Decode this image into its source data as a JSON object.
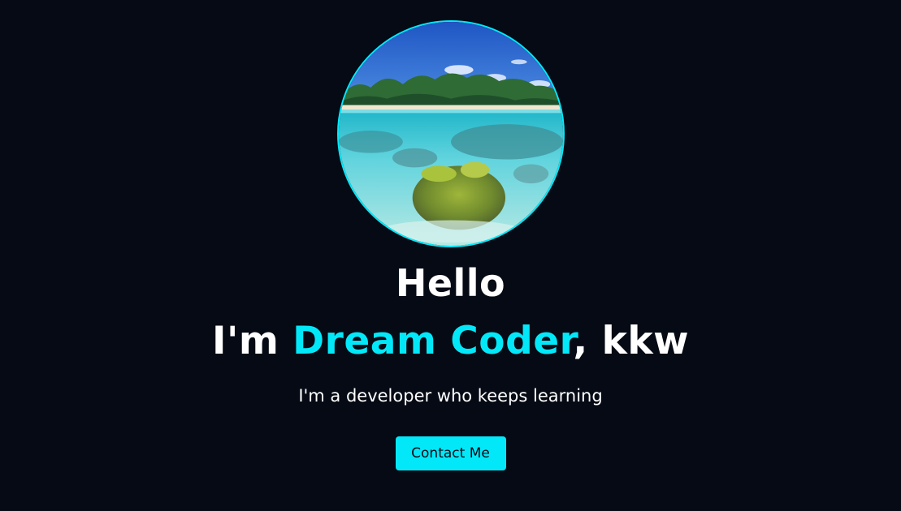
{
  "hero": {
    "greeting": "Hello",
    "headline_prefix": "I'm ",
    "name": "Dream Coder",
    "headline_suffix": ", kkw",
    "subtitle": "I'm a developer who keeps learning",
    "contact_label": "Contact Me"
  },
  "colors": {
    "background": "#050a14",
    "accent": "#03e8f9",
    "text": "#ffffff"
  }
}
